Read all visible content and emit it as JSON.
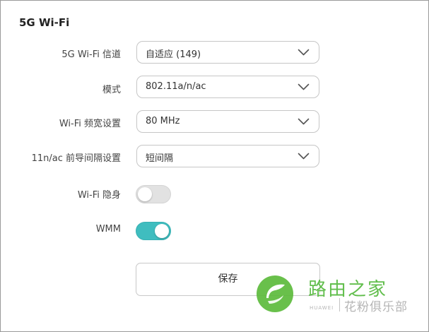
{
  "section": {
    "title": "5G Wi-Fi"
  },
  "settings": [
    {
      "label": "5G Wi-Fi 信道",
      "value": "自适应 (149)"
    },
    {
      "label": "模式",
      "value": "802.11a/n/ac"
    },
    {
      "label": "Wi-Fi 频宽设置",
      "value": "80 MHz"
    },
    {
      "label": "11n/ac 前导间隔设置",
      "value": "短间隔"
    }
  ],
  "toggles": {
    "hidden": {
      "label": "Wi-Fi 隐身",
      "state": "off"
    },
    "wmm": {
      "label": "WMM",
      "state": "on"
    }
  },
  "save_button": {
    "label": "保存"
  },
  "watermark": {
    "title": "路由之家",
    "brand": "HUAWEI",
    "subtitle": "花粉俱乐部"
  },
  "colors": {
    "toggle_on": "#3fbdbf",
    "toggle_off": "#e2e2e2",
    "watermark_green": "#52b83a"
  },
  "icons": {
    "dropdown": "chevron-down-icon",
    "watermark_logo": "leaf-logo-icon"
  }
}
